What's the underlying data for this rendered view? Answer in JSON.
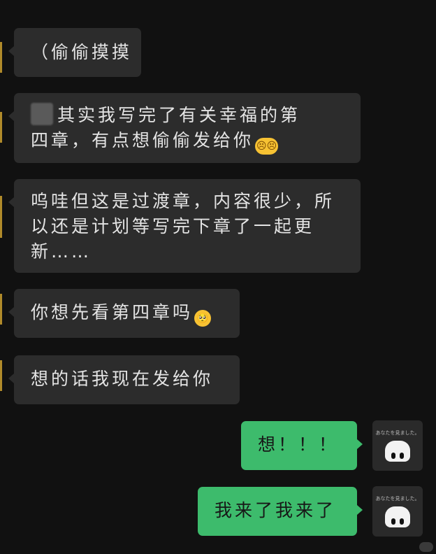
{
  "chat": {
    "messages": [
      {
        "side": "in",
        "text": "（偷偷摸摸"
      },
      {
        "side": "in",
        "line1": "其实我写完了有关幸福的第",
        "line2": "四章，有点想偷偷发给你",
        "emoji": "😣😣"
      },
      {
        "side": "in",
        "line1": "呜哇但这是过渡章，内容很少，所",
        "line2": "以还是计划等写完下章了一起更",
        "line3": "新……"
      },
      {
        "side": "in",
        "text": "你想先看第四章吗",
        "emoji": "🥺"
      },
      {
        "side": "in",
        "text": "想的话我现在发给你"
      },
      {
        "side": "out",
        "text": "想！！！"
      },
      {
        "side": "out",
        "text": "我来了我来了"
      }
    ],
    "avatar": {
      "caption": "あなたを見ました。"
    }
  },
  "colors": {
    "background": "#111111",
    "incoming_bubble": "#2c2c2c",
    "outgoing_bubble": "#3dbb6c"
  },
  "icons": [
    "sticker-thumbnail-icon",
    "persevering-face-emoji-icon",
    "pleading-face-emoji-icon",
    "ghost-avatar-icon"
  ]
}
